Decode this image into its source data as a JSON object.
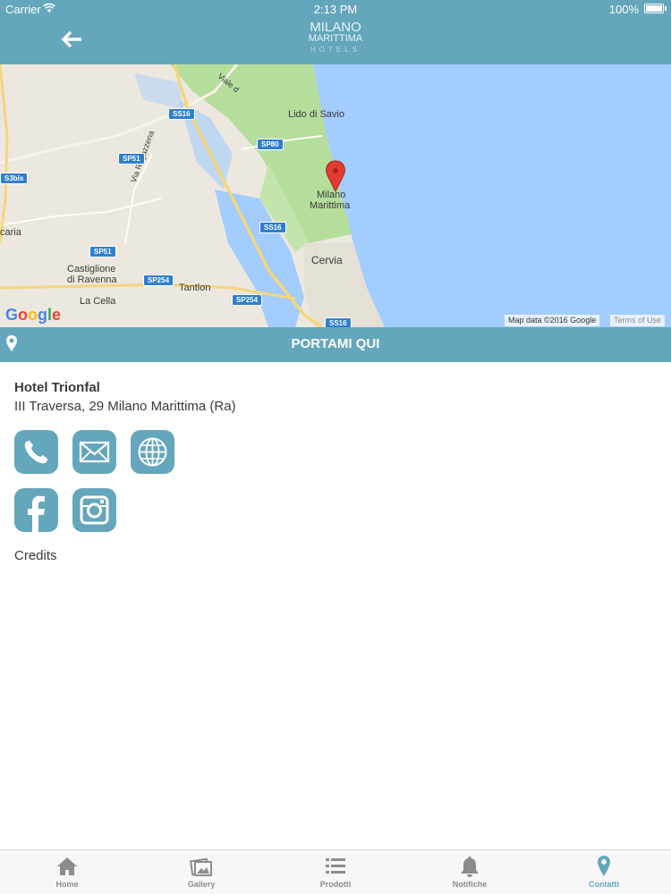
{
  "status_bar": {
    "carrier": "Carrier",
    "time": "2:13 PM",
    "battery": "100%"
  },
  "header": {
    "logo_line1": "MILANO",
    "logo_line2": "MARITTIMA",
    "logo_line3": "HOTELS"
  },
  "map": {
    "labels": {
      "lido_di_savio": "Lido di Savio",
      "milano_marittima_1": "Milano",
      "milano_marittima_2": "Marittima",
      "cervia": "Cervia",
      "castiglione_1": "Castiglione",
      "castiglione_2": "di Ravenna",
      "tantlon": "Tantlon",
      "la_cella": "La Cella",
      "via_ragazzena": "Via Ragazzena",
      "viale": "Viale d",
      "carla": "caria"
    },
    "shields": {
      "ss16_a": "SS16",
      "sp80": "SP80",
      "sp51_a": "SP51",
      "s3bis": "S3bis",
      "ss16_b": "SS16",
      "sp51_b": "SP51",
      "sp254_a": "SP254",
      "sp254_b": "SP254",
      "ss16_c": "SS16"
    },
    "attribution": "Map data ©2016 Google",
    "terms": "Terms of Use",
    "colors": {
      "water": "#a3ccff",
      "land": "#ece8df",
      "park": "#b5dd9c"
    }
  },
  "directions": {
    "label": "PORTAMI QUI"
  },
  "hotel": {
    "name": "Hotel Trionfal",
    "address": "III Traversa, 29 Milano Marittima (Ra)"
  },
  "contacts": [
    {
      "icon": "phone-icon"
    },
    {
      "icon": "mail-icon"
    },
    {
      "icon": "globe-icon"
    },
    {
      "icon": "facebook-icon"
    },
    {
      "icon": "instagram-icon"
    }
  ],
  "credits": "Credits",
  "tabs": [
    {
      "label": "Home",
      "icon": "home-icon",
      "active": false
    },
    {
      "label": "Gallery",
      "icon": "gallery-icon",
      "active": false
    },
    {
      "label": "Prodotti",
      "icon": "list-icon",
      "active": false
    },
    {
      "label": "Notifiche",
      "icon": "bell-icon",
      "active": false
    },
    {
      "label": "Contatti",
      "icon": "location-pin-icon",
      "active": true
    }
  ],
  "accent_color": "#64a6bb"
}
